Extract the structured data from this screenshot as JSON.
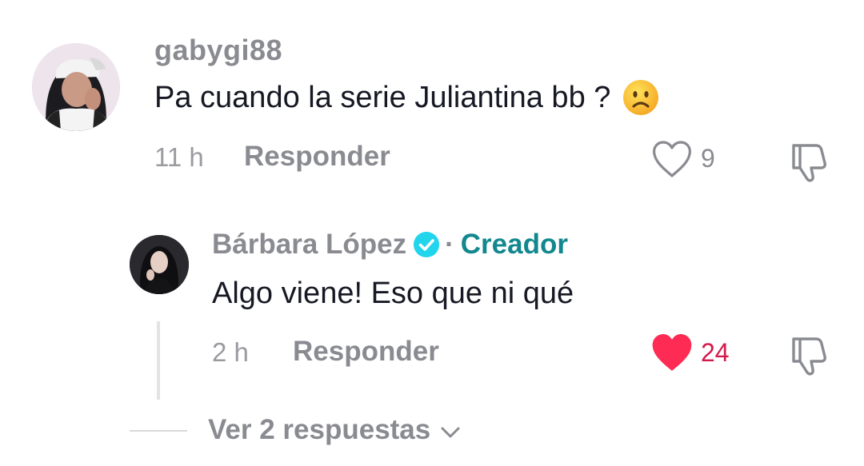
{
  "comment": {
    "username": "gabygi88",
    "text": "Pa cuando la serie Juliantina bb ?",
    "emoji": "frowning-face-emoji",
    "time": "11 h",
    "reply_label": "Responder",
    "like_count": "9",
    "liked": false
  },
  "reply": {
    "username": "Bárbara López",
    "separator": "·",
    "creator_label": "Creador",
    "text": "Algo viene! Eso que ni qué",
    "time": "2 h",
    "reply_label": "Responder",
    "like_count": "24",
    "liked": true
  },
  "view_replies": {
    "label": "Ver 2 respuestas"
  },
  "colors": {
    "username_gray": "#8a8b91",
    "creator_teal": "#12888e",
    "verified_blue": "#20d5ec",
    "like_red": "#fe2c55",
    "like_count_red": "#d21a4c"
  },
  "icons": {
    "like": "heart-icon",
    "dislike": "thumbs-down-icon",
    "verified": "verified-badge-icon",
    "expand": "chevron-down-icon"
  }
}
